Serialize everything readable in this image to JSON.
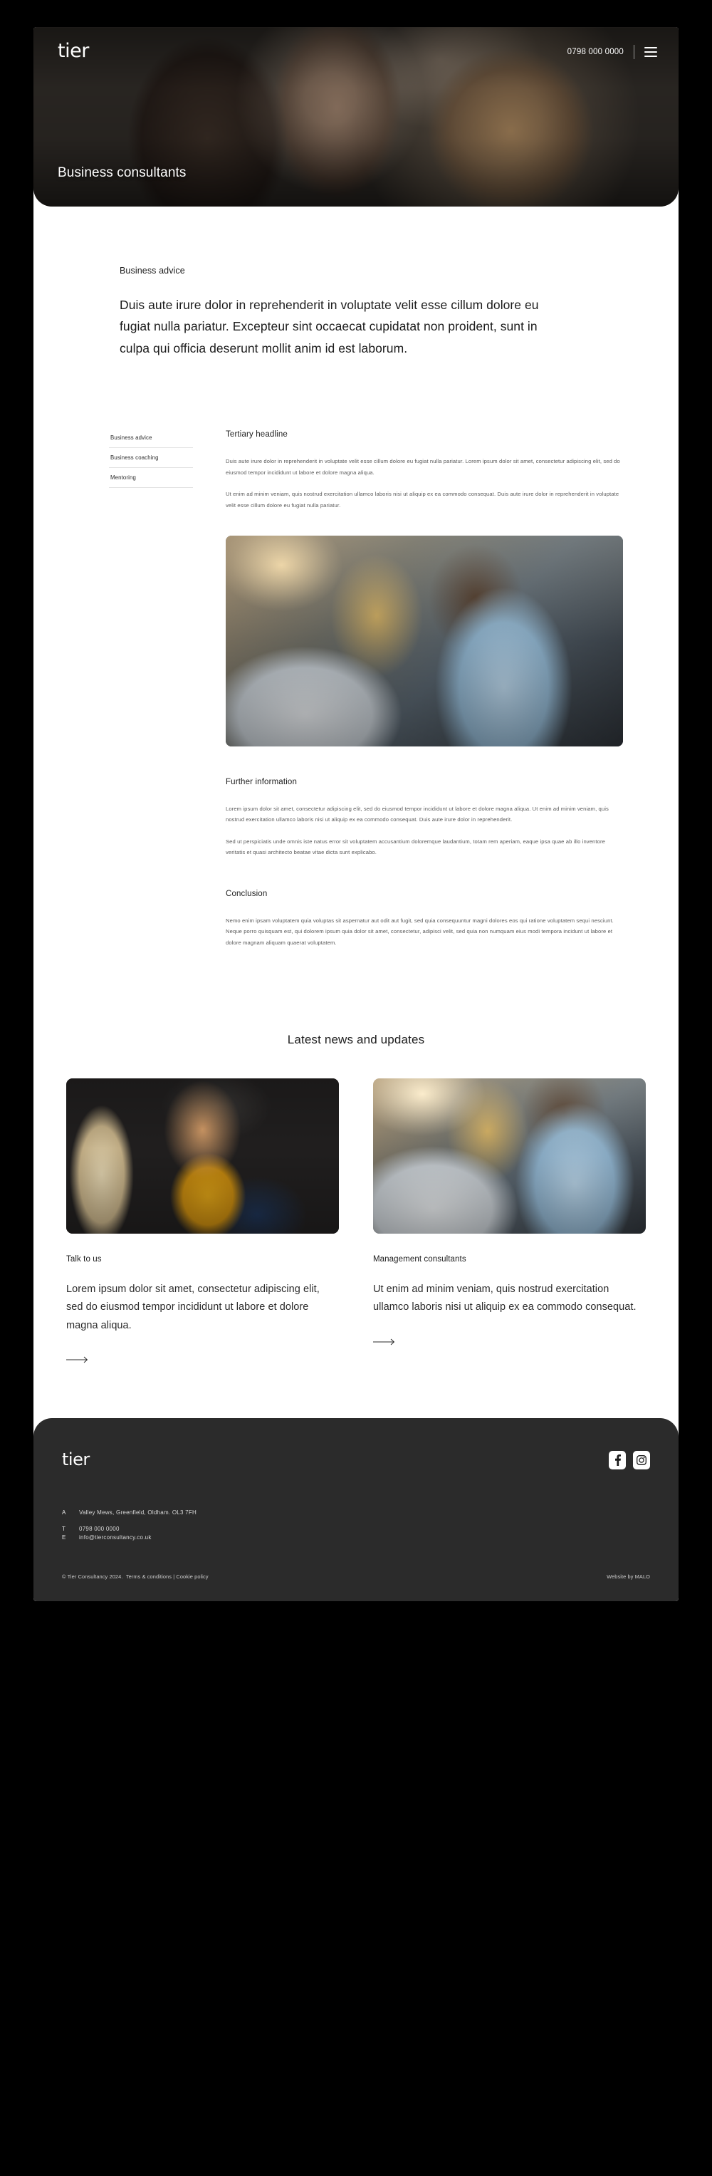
{
  "site": {
    "logo_text": "tier",
    "phone": "0798 000 0000",
    "menu_icon": "hamburger-menu-icon"
  },
  "hero": {
    "title": "Business consultants"
  },
  "intro": {
    "eyebrow": "Business advice",
    "lede": "Duis aute irure dolor in reprehenderit in voluptate velit esse cillum dolore eu fugiat nulla pariatur. Excepteur sint occaecat cupidatat non proident, sunt in culpa qui officia deserunt mollit anim id est laborum."
  },
  "side_nav": {
    "items": [
      {
        "label": "Business advice"
      },
      {
        "label": "Business coaching"
      },
      {
        "label": "Mentoring"
      }
    ]
  },
  "article": {
    "headline": "Tertiary headline",
    "paragraphs": [
      "Duis aute irure dolor in reprehenderit in voluptate velit esse cillum dolore eu fugiat nulla pariatur. Lorem ipsum dolor sit amet, consectetur adipiscing elit, sed do eiusmod tempor incididunt ut labore et dolore magna aliqua.",
      "Ut enim ad minim veniam, quis nostrud exercitation ullamco laboris nisi ut aliquip ex ea commodo consequat. Duis aute irure dolor in reprehenderit in voluptate velit esse cillum dolore eu fugiat nulla pariatur."
    ],
    "image_alt": "man-writing-at-desk-photo",
    "further": {
      "headline": "Further information",
      "paragraphs": [
        "Lorem ipsum dolor sit amet, consectetur adipiscing elit, sed do eiusmod tempor incididunt ut labore et dolore magna aliqua. Ut enim ad minim veniam, quis nostrud exercitation ullamco laboris nisi ut aliquip ex ea commodo consequat. Duis aute irure dolor in reprehenderit.",
        "Sed ut perspiciatis unde omnis iste natus error sit voluptatem accusantium doloremque laudantium, totam rem aperiam, eaque ipsa quae ab illo inventore veritatis et quasi architecto beatae vitae dicta sunt explicabo."
      ]
    },
    "conclusion": {
      "headline": "Conclusion",
      "paragraphs": [
        "Nemo enim ipsam voluptatem quia voluptas sit aspernatur aut odit aut fugit, sed quia consequuntur magni dolores eos qui ratione voluptatem sequi nesciunt. Neque porro quisquam est, qui dolorem ipsum quia dolor sit amet, consectetur, adipisci velit, sed quia non numquam eius modi tempora incidunt ut labore et dolore magnam aliquam quaerat voluptatem."
      ]
    }
  },
  "news": {
    "title": "Latest news and updates",
    "cards": [
      {
        "eyebrow": "Talk to us",
        "text": "Lorem ipsum dolor sit amet, consectetur adipiscing elit, sed do eiusmod tempor incididunt ut labore et dolore magna aliqua.",
        "image_alt": "two-people-in-conversation-photo",
        "link_icon": "arrow-right-icon"
      },
      {
        "eyebrow": "Management consultants",
        "text": "Ut enim ad minim veniam, quis nostrud exercitation ullamco laboris nisi ut aliquip ex ea commodo consequat.",
        "image_alt": "man-writing-at-desk-photo",
        "link_icon": "arrow-right-icon"
      }
    ]
  },
  "footer": {
    "logo_text": "tier",
    "socials": [
      {
        "name": "facebook-icon"
      },
      {
        "name": "instagram-icon"
      }
    ],
    "contact": [
      {
        "key": "A",
        "value": "Valley Mews, Greenfield, Oldham. OL3 7FH"
      },
      {
        "key": "T",
        "value": "0798 000 0000"
      },
      {
        "key": "E",
        "value": "info@tierconsultancy.co.uk"
      }
    ],
    "copyright": "© Tier Consultancy 2024.",
    "terms": "Terms & conditions",
    "separator": "|",
    "cookies": "Cookie policy",
    "credit": "Website by MALO"
  },
  "colors": {
    "page_bg": "#000000",
    "surface": "#ffffff",
    "footer_bg": "#2b2b2b",
    "text_primary": "#1c1c1c",
    "text_muted": "#5a5a5a",
    "rule": "#e2e2e2"
  }
}
